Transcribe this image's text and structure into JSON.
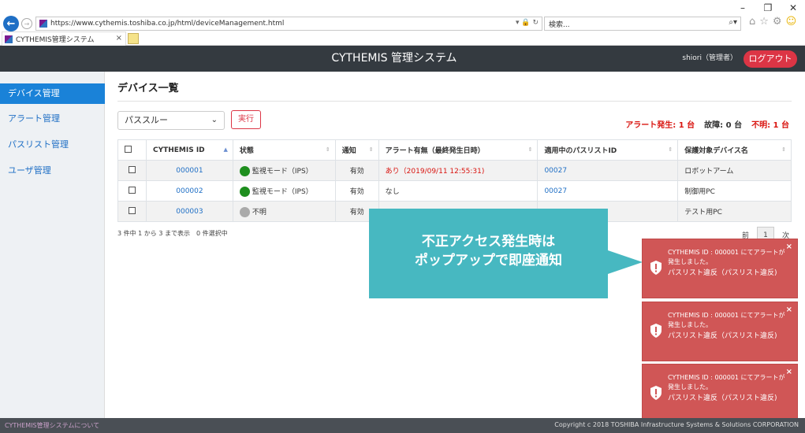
{
  "browser": {
    "url": "https://www.cythemis.toshiba.co.jp/html/deviceManagement.html",
    "search_placeholder": "検索...",
    "tab_title": "CYTHEMIS管理システム"
  },
  "header": {
    "title": "CYTHEMIS 管理システム",
    "user": "shiori（管理者）",
    "logout": "ログアウト"
  },
  "sidebar": {
    "items": [
      {
        "label": "デバイス管理"
      },
      {
        "label": "アラート管理"
      },
      {
        "label": "パスリスト管理"
      },
      {
        "label": "ユーザ管理"
      }
    ]
  },
  "main": {
    "title": "デバイス一覧",
    "select_value": "パススルー",
    "exec_label": "実行",
    "stats": {
      "alert": "アラート発生: 1 台",
      "fault": "故障: 0 台",
      "unknown": "不明: 1 台"
    },
    "columns": [
      "CYTHEMIS ID",
      "状態",
      "通知",
      "アラート有無（最終発生日時）",
      "適用中のパスリストID",
      "保護対象デバイス名"
    ],
    "rows": [
      {
        "id": "000001",
        "status": "監視モード（IPS）",
        "notify": "有効",
        "alert": "あり（2019/09/11 12:55:31)",
        "passlist": "00027",
        "device": "ロボットアーム"
      },
      {
        "id": "000002",
        "status": "監視モード（IPS）",
        "notify": "有効",
        "alert": "なし",
        "passlist": "00027",
        "device": "制御用PC"
      },
      {
        "id": "000003",
        "status": "不明",
        "notify": "有効",
        "alert": "",
        "passlist": "",
        "device": "テスト用PC"
      }
    ],
    "page_info": "3 件中 1 から 3 まで表示　0 件選択中",
    "pager": {
      "prev": "前",
      "current": "1",
      "next": "次"
    }
  },
  "callout": {
    "line1": "不正アクセス発生時は",
    "line2": "ポップアップで即座通知"
  },
  "toasts": [
    {
      "message": "CYTHEMIS ID : 000001 にてアラートが発生しました。",
      "detail": "パスリスト違反（パスリスト違反)",
      "close": "×"
    },
    {
      "message": "CYTHEMIS ID : 000001 にてアラートが発生しました。",
      "detail": "パスリスト違反（パスリスト違反)",
      "close": "×"
    },
    {
      "message": "CYTHEMIS ID : 000001 にてアラートが発生しました。",
      "detail": "パスリスト違反（パスリスト違反)",
      "close": "×"
    }
  ],
  "footer": {
    "about": "CYTHEMIS管理システムについて",
    "copyright": "Copyright c 2018 TOSHIBA Infrastructure Systems & Solutions CORPORATION"
  },
  "colors": {
    "header_bg": "#343a40",
    "logout": "#dc3545",
    "sidebar_active": "#1a82d8",
    "callout": "#47b8c1",
    "toast": "#d05656",
    "status_ok": "#1e8e1e",
    "status_unknown": "#aaaaaa"
  }
}
